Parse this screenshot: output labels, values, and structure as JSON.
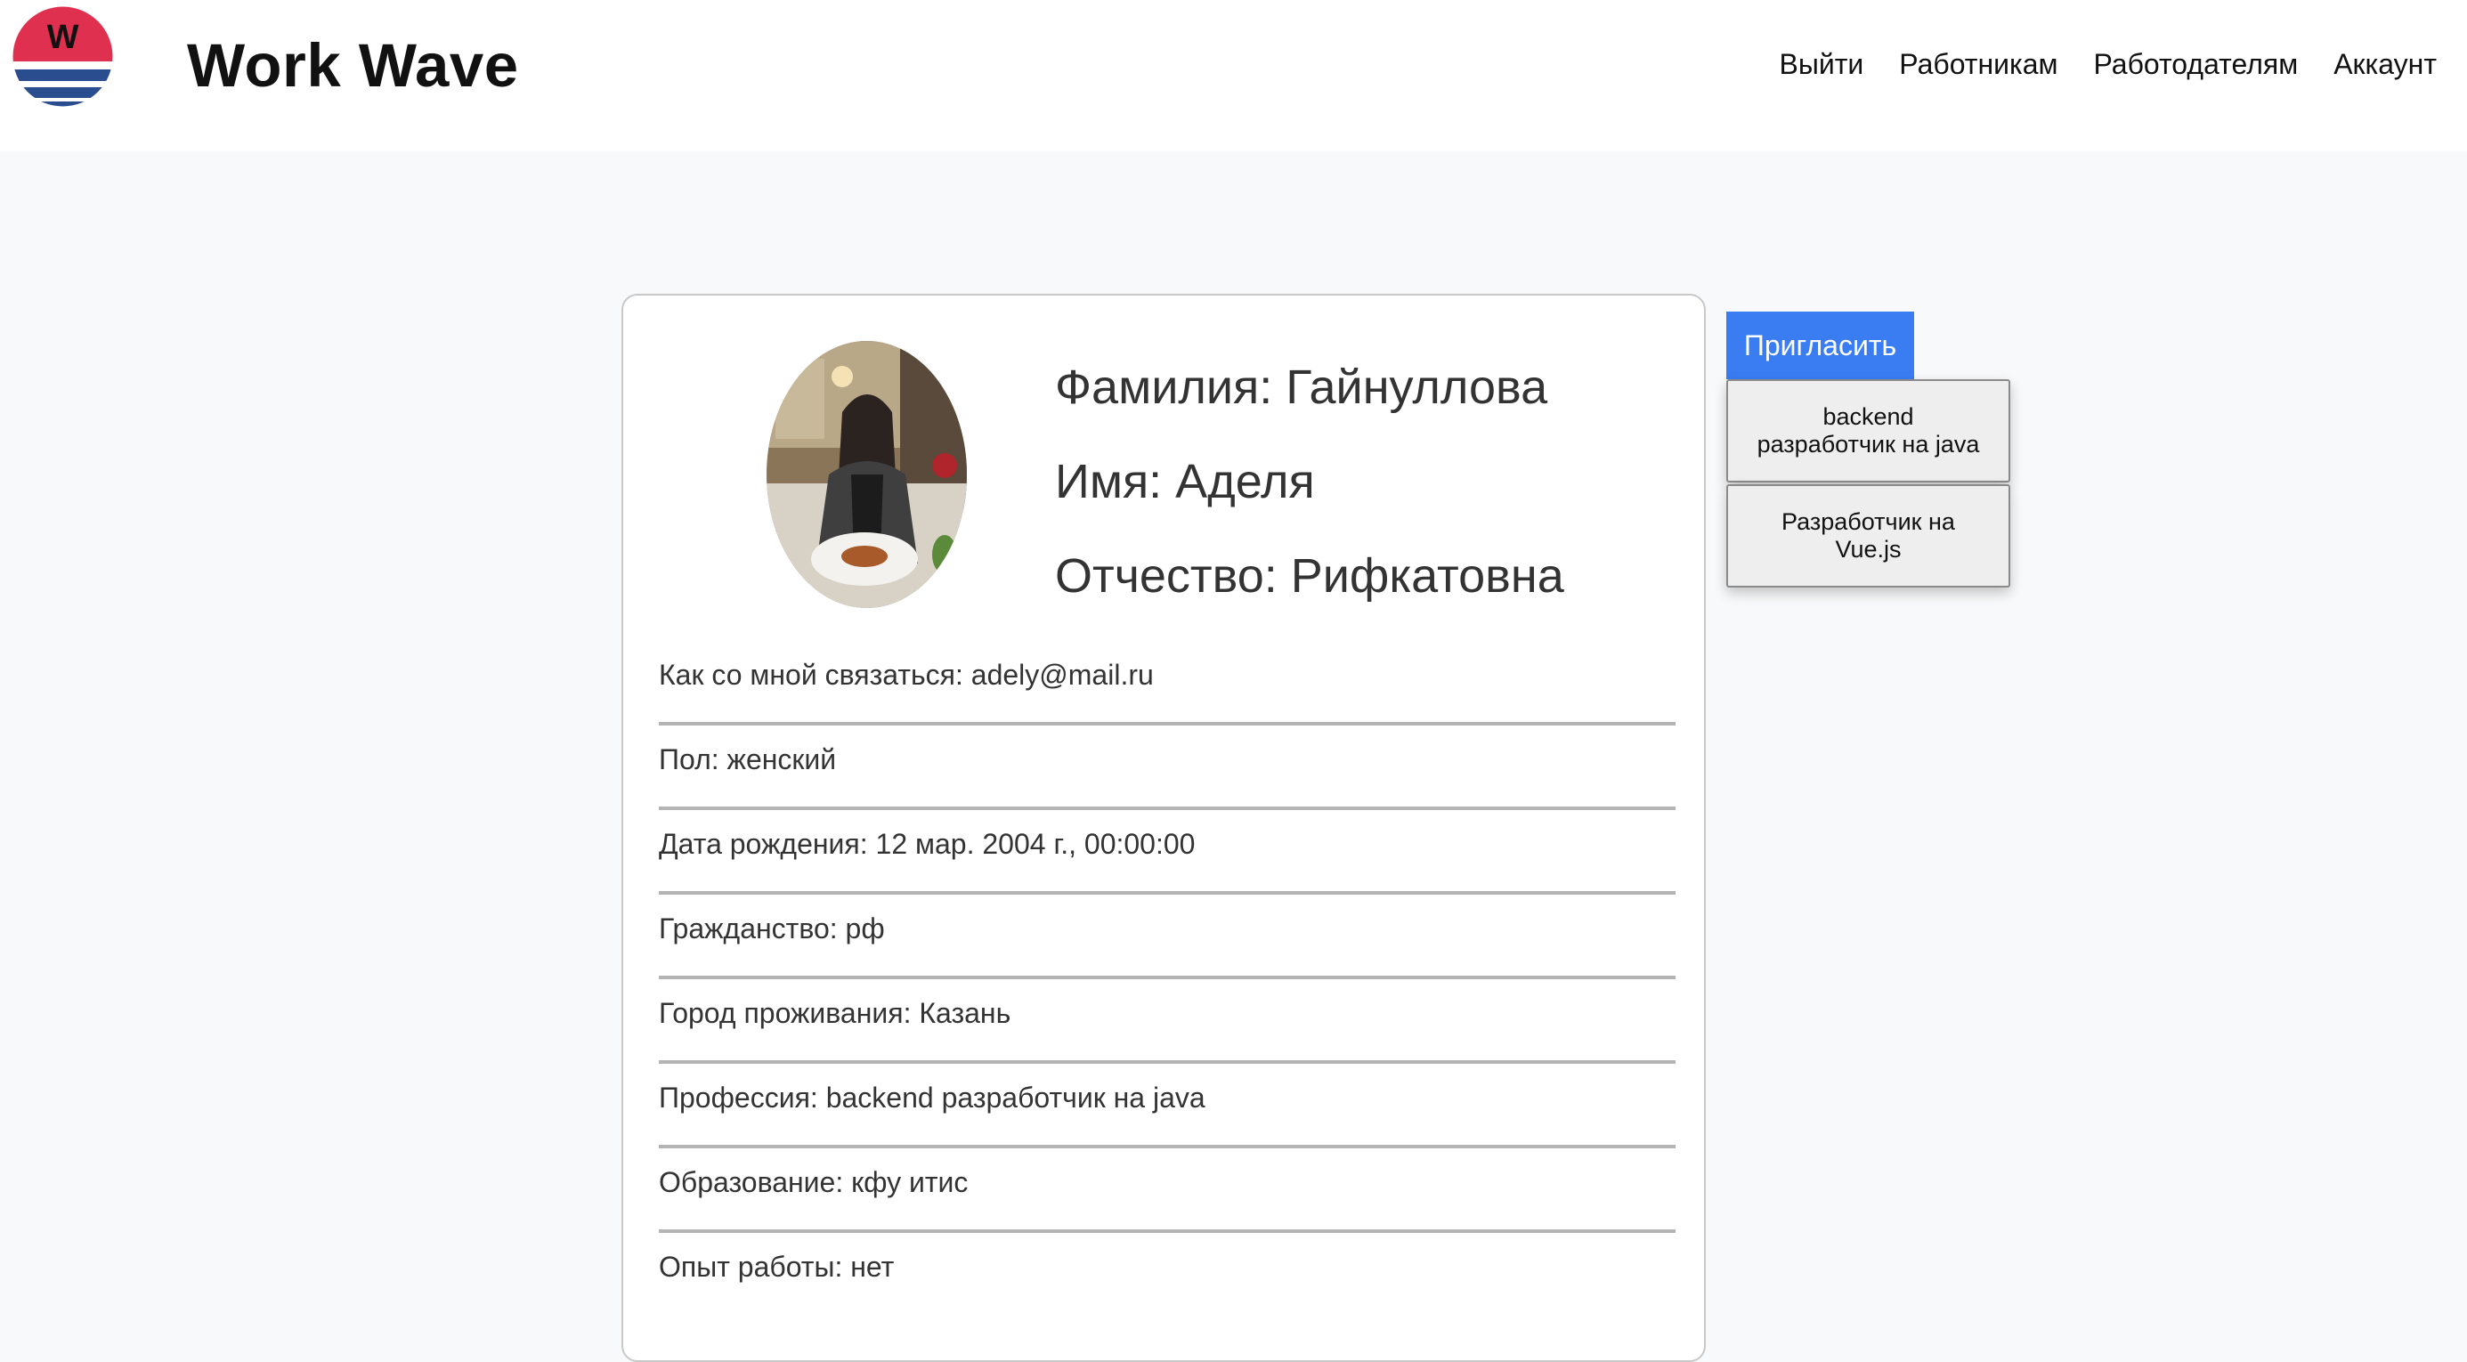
{
  "header": {
    "logo_letter": "W",
    "brand": "Work Wave",
    "nav": [
      "Выйти",
      "Работникам",
      "Работодателям",
      "Аккаунт"
    ]
  },
  "profile": {
    "surname": "Фамилия: Гайнуллова",
    "name": "Имя: Аделя",
    "patronymic": "Отчество: Рифкатовна",
    "fields": [
      "Как со мной связаться: adely@mail.ru",
      "Пол: женский",
      "Дата рождения: 12 мар. 2004 г., 00:00:00",
      "Гражданство: рф",
      "Город проживания: Казань",
      "Профессия: backend разработчик на java",
      "Образование: кфу итис",
      "Опыт работы: нет"
    ]
  },
  "invite": {
    "button_label": "Пригласить",
    "options": [
      "backend разработчик на java",
      "Разработчик на Vue.js"
    ]
  },
  "colors": {
    "logo_red": "#e0304f",
    "logo_blue": "#2a4d8f",
    "invite_button": "#3a7df3",
    "background": "#f8f9fa"
  }
}
